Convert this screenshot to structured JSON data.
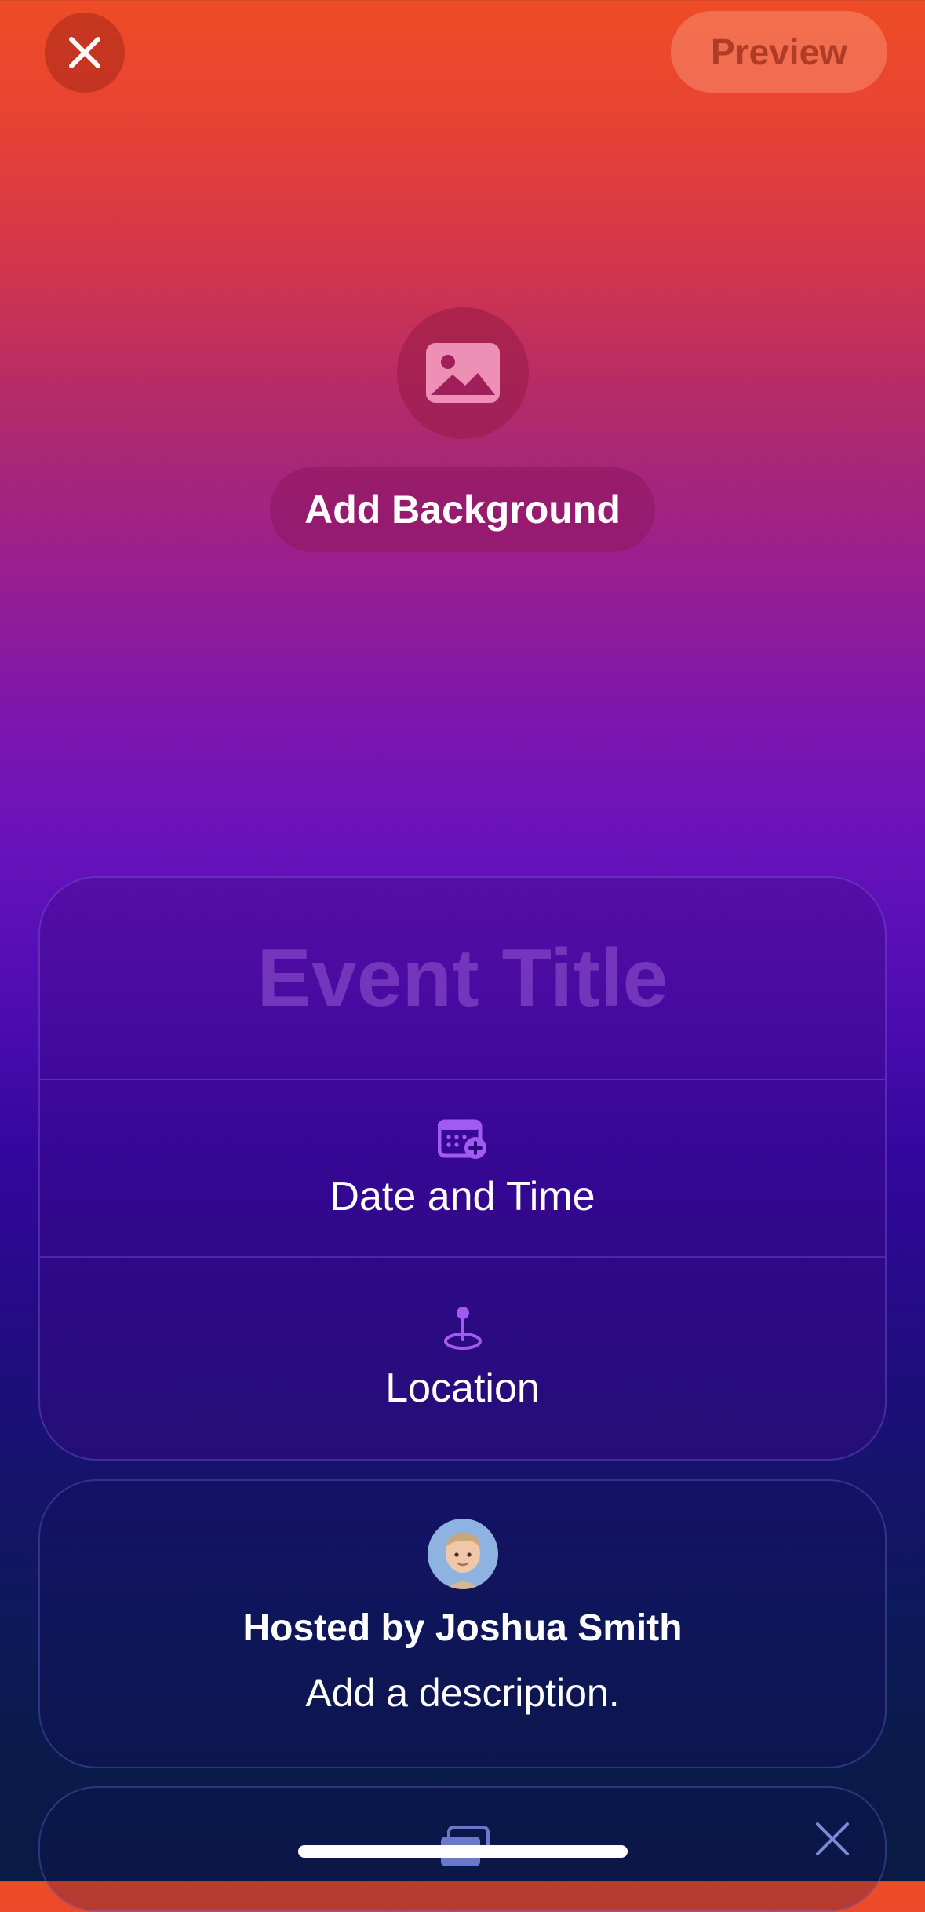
{
  "toolbar": {
    "close_icon": "close-icon",
    "preview_label": "Preview"
  },
  "background": {
    "icon": "photo-icon",
    "add_label": "Add Background"
  },
  "event": {
    "title_placeholder": "Event Title",
    "date_time_label": "Date and Time",
    "date_time_icon": "calendar-add-icon",
    "location_label": "Location",
    "location_icon": "location-pin-icon"
  },
  "host": {
    "avatar_icon": "memoji-avatar",
    "hosted_by": "Hosted by Joshua Smith",
    "description_placeholder": "Add a description."
  },
  "bottom_card": {
    "icon": "photos-stack-icon",
    "dismiss_icon": "close-icon"
  },
  "colors": {
    "gradient_top": "#ee4c26",
    "gradient_mid": "#6812bc",
    "gradient_bottom": "#091a44",
    "accent_purple": "#a15bf0"
  }
}
